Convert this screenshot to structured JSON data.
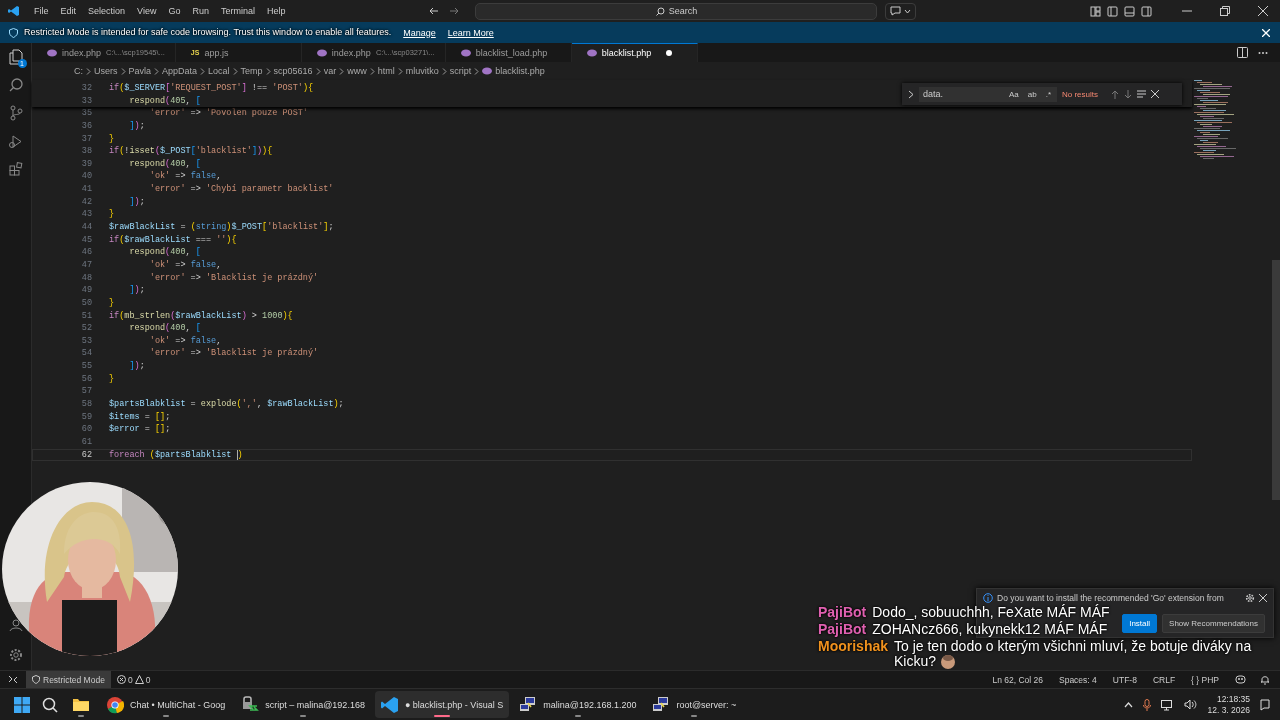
{
  "title_bar": {
    "menu": [
      "File",
      "Edit",
      "Selection",
      "View",
      "Go",
      "Run",
      "Terminal",
      "Help"
    ],
    "search": {
      "placeholder": "Search"
    }
  },
  "banner": {
    "message": "Restricted Mode is intended for safe code browsing. Trust this window to enable all features.",
    "links": [
      "Manage",
      "Learn More"
    ]
  },
  "activity_bar": {
    "explorer_badge": "1"
  },
  "tabs": [
    {
      "label": "index.php",
      "description": "C:\\...\\scp19545\\...",
      "kind": "php",
      "selected": false,
      "dirty": false
    },
    {
      "label": "app.js",
      "kind": "js",
      "icon_text": "JS",
      "selected": false,
      "dirty": false
    },
    {
      "label": "index.php",
      "description": "C:\\...\\scp03271\\...",
      "kind": "php",
      "selected": false,
      "dirty": false
    },
    {
      "label": "blacklist_load.php",
      "kind": "php",
      "selected": false,
      "dirty": false
    },
    {
      "label": "blacklist.php",
      "kind": "php",
      "selected": true,
      "dirty": true
    }
  ],
  "breadcrumb": [
    "C:",
    "Users",
    "Pavla",
    "AppData",
    "Local",
    "Temp",
    "scp05616",
    "var",
    "www",
    "html",
    "mluvitko",
    "script",
    "blacklist.php"
  ],
  "find_widget": {
    "value": "data.",
    "toggles": [
      {
        "label": "Aa",
        "on": false
      },
      {
        "label": "ab",
        "on": false
      },
      {
        "label": ".*",
        "on": false
      }
    ],
    "result": "No results"
  },
  "editor": {
    "sticky_lines": [
      {
        "no": "32",
        "tokens": [
          {
            "kind": "kw",
            "text": "if"
          },
          {
            "kind": "b1",
            "text": "("
          },
          {
            "kind": "var",
            "text": "$_SERVER"
          },
          {
            "kind": "b2",
            "text": "["
          },
          {
            "kind": "str",
            "text": "'REQUEST_POST'"
          },
          {
            "kind": "b2",
            "text": "]"
          },
          {
            "kind": "op",
            "text": " !== "
          },
          {
            "kind": "str",
            "text": "'POST'"
          },
          {
            "kind": "b1",
            "text": ")"
          },
          {
            "kind": "b1",
            "text": "{"
          }
        ]
      },
      {
        "no": "33",
        "tokens": [
          {
            "kind": "fn",
            "text": "    respond"
          },
          {
            "kind": "b2",
            "text": "("
          },
          {
            "kind": "num",
            "text": "405"
          },
          {
            "kind": "op",
            "text": ", "
          },
          {
            "kind": "b3",
            "text": "["
          }
        ]
      }
    ],
    "lines": [
      {
        "no": "35",
        "current": false,
        "tokens": [
          {
            "kind": "str",
            "text": "        'error'"
          },
          {
            "kind": "op",
            "text": " => "
          },
          {
            "kind": "str",
            "text": "'Povolen pouze POST'"
          }
        ]
      },
      {
        "no": "36",
        "current": false,
        "tokens": [
          {
            "kind": "b3",
            "text": "    ]"
          },
          {
            "kind": "b2",
            "text": ")"
          },
          {
            "kind": "op",
            "text": ";"
          }
        ]
      },
      {
        "no": "37",
        "current": false,
        "tokens": [
          {
            "kind": "b1",
            "text": "}"
          }
        ]
      },
      {
        "no": "38",
        "current": false,
        "tokens": [
          {
            "kind": "kw",
            "text": "if"
          },
          {
            "kind": "b1",
            "text": "("
          },
          {
            "kind": "op",
            "text": "!"
          },
          {
            "kind": "fn",
            "text": "isset"
          },
          {
            "kind": "b2",
            "text": "("
          },
          {
            "kind": "var",
            "text": "$_POST"
          },
          {
            "kind": "b3",
            "text": "["
          },
          {
            "kind": "str",
            "text": "'blacklist'"
          },
          {
            "kind": "b3",
            "text": "]"
          },
          {
            "kind": "b2",
            "text": ")"
          },
          {
            "kind": "b1",
            "text": ")"
          },
          {
            "kind": "b1",
            "text": "{"
          }
        ]
      },
      {
        "no": "39",
        "current": false,
        "tokens": [
          {
            "kind": "fn",
            "text": "    respond"
          },
          {
            "kind": "b2",
            "text": "("
          },
          {
            "kind": "num",
            "text": "400"
          },
          {
            "kind": "op",
            "text": ", "
          },
          {
            "kind": "b3",
            "text": "["
          }
        ]
      },
      {
        "no": "40",
        "current": false,
        "tokens": [
          {
            "kind": "str",
            "text": "        'ok'"
          },
          {
            "kind": "op",
            "text": " => "
          },
          {
            "kind": "const",
            "text": "false"
          },
          {
            "kind": "op",
            "text": ","
          }
        ]
      },
      {
        "no": "41",
        "current": false,
        "tokens": [
          {
            "kind": "str",
            "text": "        'error'"
          },
          {
            "kind": "op",
            "text": " => "
          },
          {
            "kind": "str",
            "text": "'Chybí parametr backlist'"
          }
        ]
      },
      {
        "no": "42",
        "current": false,
        "tokens": [
          {
            "kind": "b3",
            "text": "    ]"
          },
          {
            "kind": "b2",
            "text": ")"
          },
          {
            "kind": "op",
            "text": ";"
          }
        ]
      },
      {
        "no": "43",
        "current": false,
        "tokens": [
          {
            "kind": "b1",
            "text": "}"
          }
        ]
      },
      {
        "no": "44",
        "current": false,
        "tokens": [
          {
            "kind": "var",
            "text": "$rawBlackList"
          },
          {
            "kind": "op",
            "text": " = "
          },
          {
            "kind": "b1",
            "text": "("
          },
          {
            "kind": "const",
            "text": "string"
          },
          {
            "kind": "b1",
            "text": ")"
          },
          {
            "kind": "var",
            "text": "$_POST"
          },
          {
            "kind": "b1",
            "text": "["
          },
          {
            "kind": "str",
            "text": "'blacklist'"
          },
          {
            "kind": "b1",
            "text": "]"
          },
          {
            "kind": "op",
            "text": ";"
          }
        ]
      },
      {
        "no": "45",
        "current": false,
        "tokens": [
          {
            "kind": "kw",
            "text": "if"
          },
          {
            "kind": "b1",
            "text": "("
          },
          {
            "kind": "var",
            "text": "$rawBlackList"
          },
          {
            "kind": "op",
            "text": " === "
          },
          {
            "kind": "str",
            "text": "''"
          },
          {
            "kind": "b1",
            "text": ")"
          },
          {
            "kind": "b1",
            "text": "{"
          }
        ]
      },
      {
        "no": "46",
        "current": false,
        "tokens": [
          {
            "kind": "fn",
            "text": "    respond"
          },
          {
            "kind": "b2",
            "text": "("
          },
          {
            "kind": "num",
            "text": "400"
          },
          {
            "kind": "op",
            "text": ", "
          },
          {
            "kind": "b3",
            "text": "["
          }
        ]
      },
      {
        "no": "47",
        "current": false,
        "tokens": [
          {
            "kind": "str",
            "text": "        'ok'"
          },
          {
            "kind": "op",
            "text": " => "
          },
          {
            "kind": "const",
            "text": "false"
          },
          {
            "kind": "op",
            "text": ","
          }
        ]
      },
      {
        "no": "48",
        "current": false,
        "tokens": [
          {
            "kind": "str",
            "text": "        'error'"
          },
          {
            "kind": "op",
            "text": " => "
          },
          {
            "kind": "str",
            "text": "'Blacklist je prázdný'"
          }
        ]
      },
      {
        "no": "49",
        "current": false,
        "tokens": [
          {
            "kind": "b3",
            "text": "    ]"
          },
          {
            "kind": "b2",
            "text": ")"
          },
          {
            "kind": "op",
            "text": ";"
          }
        ]
      },
      {
        "no": "50",
        "current": false,
        "tokens": [
          {
            "kind": "b1",
            "text": "}"
          }
        ]
      },
      {
        "no": "51",
        "current": false,
        "tokens": [
          {
            "kind": "kw",
            "text": "if"
          },
          {
            "kind": "b1",
            "text": "("
          },
          {
            "kind": "fn",
            "text": "mb_strlen"
          },
          {
            "kind": "b2",
            "text": "("
          },
          {
            "kind": "var",
            "text": "$rawBlackList"
          },
          {
            "kind": "b2",
            "text": ")"
          },
          {
            "kind": "op",
            "text": " > "
          },
          {
            "kind": "num",
            "text": "1000"
          },
          {
            "kind": "b1",
            "text": ")"
          },
          {
            "kind": "b1",
            "text": "{"
          }
        ]
      },
      {
        "no": "52",
        "current": false,
        "tokens": [
          {
            "kind": "fn",
            "text": "    respond"
          },
          {
            "kind": "b2",
            "text": "("
          },
          {
            "kind": "num",
            "text": "400"
          },
          {
            "kind": "op",
            "text": ", "
          },
          {
            "kind": "b3",
            "text": "["
          }
        ]
      },
      {
        "no": "53",
        "current": false,
        "tokens": [
          {
            "kind": "str",
            "text": "        'ok'"
          },
          {
            "kind": "op",
            "text": " => "
          },
          {
            "kind": "const",
            "text": "false"
          },
          {
            "kind": "op",
            "text": ","
          }
        ]
      },
      {
        "no": "54",
        "current": false,
        "tokens": [
          {
            "kind": "str",
            "text": "        'error'"
          },
          {
            "kind": "op",
            "text": " => "
          },
          {
            "kind": "str",
            "text": "'Blacklist je prázdný'"
          }
        ]
      },
      {
        "no": "55",
        "current": false,
        "tokens": [
          {
            "kind": "b3",
            "text": "    ]"
          },
          {
            "kind": "b2",
            "text": ")"
          },
          {
            "kind": "op",
            "text": ";"
          }
        ]
      },
      {
        "no": "56",
        "current": false,
        "tokens": [
          {
            "kind": "b1",
            "text": "}"
          }
        ]
      },
      {
        "no": "57",
        "current": false
      },
      {
        "no": "58",
        "current": false,
        "tokens": [
          {
            "kind": "var",
            "text": "$partsBlabklist"
          },
          {
            "kind": "op",
            "text": " = "
          },
          {
            "kind": "fn",
            "text": "explode"
          },
          {
            "kind": "b1",
            "text": "("
          },
          {
            "kind": "str",
            "text": "','"
          },
          {
            "kind": "op",
            "text": ", "
          },
          {
            "kind": "var",
            "text": "$rawBlackList"
          },
          {
            "kind": "b1",
            "text": ")"
          },
          {
            "kind": "op",
            "text": ";"
          }
        ]
      },
      {
        "no": "59",
        "current": false,
        "tokens": [
          {
            "kind": "var",
            "text": "$items"
          },
          {
            "kind": "op",
            "text": " = "
          },
          {
            "kind": "b1",
            "text": "[]"
          },
          {
            "kind": "op",
            "text": ";"
          }
        ]
      },
      {
        "no": "60",
        "current": false,
        "tokens": [
          {
            "kind": "var",
            "text": "$error"
          },
          {
            "kind": "op",
            "text": " = "
          },
          {
            "kind": "b1",
            "text": "[]"
          },
          {
            "kind": "op",
            "text": ";"
          }
        ]
      },
      {
        "no": "61",
        "current": false
      },
      {
        "no": "62",
        "current": true,
        "tokens": [
          {
            "kind": "kw",
            "text": "foreach "
          },
          {
            "kind": "b1",
            "text": "("
          },
          {
            "kind": "var",
            "text": "$partsBlabklist "
          },
          {
            "kind": "cursor"
          },
          {
            "kind": "b1",
            "text": ")"
          }
        ]
      }
    ]
  },
  "status_bar": {
    "mode": "Restricted Mode",
    "errors": "0",
    "warnings": "0",
    "items": [
      "Ln 62, Col 26",
      "Spaces: 4",
      "UTF-8",
      "CRLF",
      "{ } PHP"
    ]
  },
  "notification": {
    "message": "Do you want to install the recommended 'Go' extension from",
    "buttons": [
      {
        "label": "Install",
        "primary": true
      },
      {
        "label": "Show Recommendations",
        "primary": false
      }
    ]
  },
  "chat": [
    {
      "user": "PajiBot",
      "color": "#e060b0",
      "text": "Dodo_, sobuuchhh, FeXate MÁF MÁF",
      "emote": false
    },
    {
      "user": "PajiBot",
      "color": "#e060b0",
      "text": "ZOHANcz666, kukynekk12 MÁF MÁF",
      "emote": false
    },
    {
      "user": "Moorishak",
      "color": "#f0921e",
      "text": "To je ten dodo o kterým všichni mluví, že botuje diváky na Kicku?",
      "emote": true
    }
  ],
  "taskbar": {
    "apps": [
      {
        "kind": "files",
        "selected": false
      },
      {
        "kind": "chrome",
        "label": "Chat • MultiChat - Goog",
        "selected": false
      },
      {
        "kind": "winscp",
        "label": "script – malina@192.168",
        "selected": false
      },
      {
        "kind": "vscode",
        "label": "● blacklist.php - Visual S",
        "selected": true
      },
      {
        "kind": "putty",
        "label": "malina@192.168.1.200",
        "selected": false
      },
      {
        "kind": "putty",
        "label": "root@server: ~",
        "selected": false
      }
    ],
    "time": "12:18:35",
    "date": "12. 3. 2026"
  }
}
